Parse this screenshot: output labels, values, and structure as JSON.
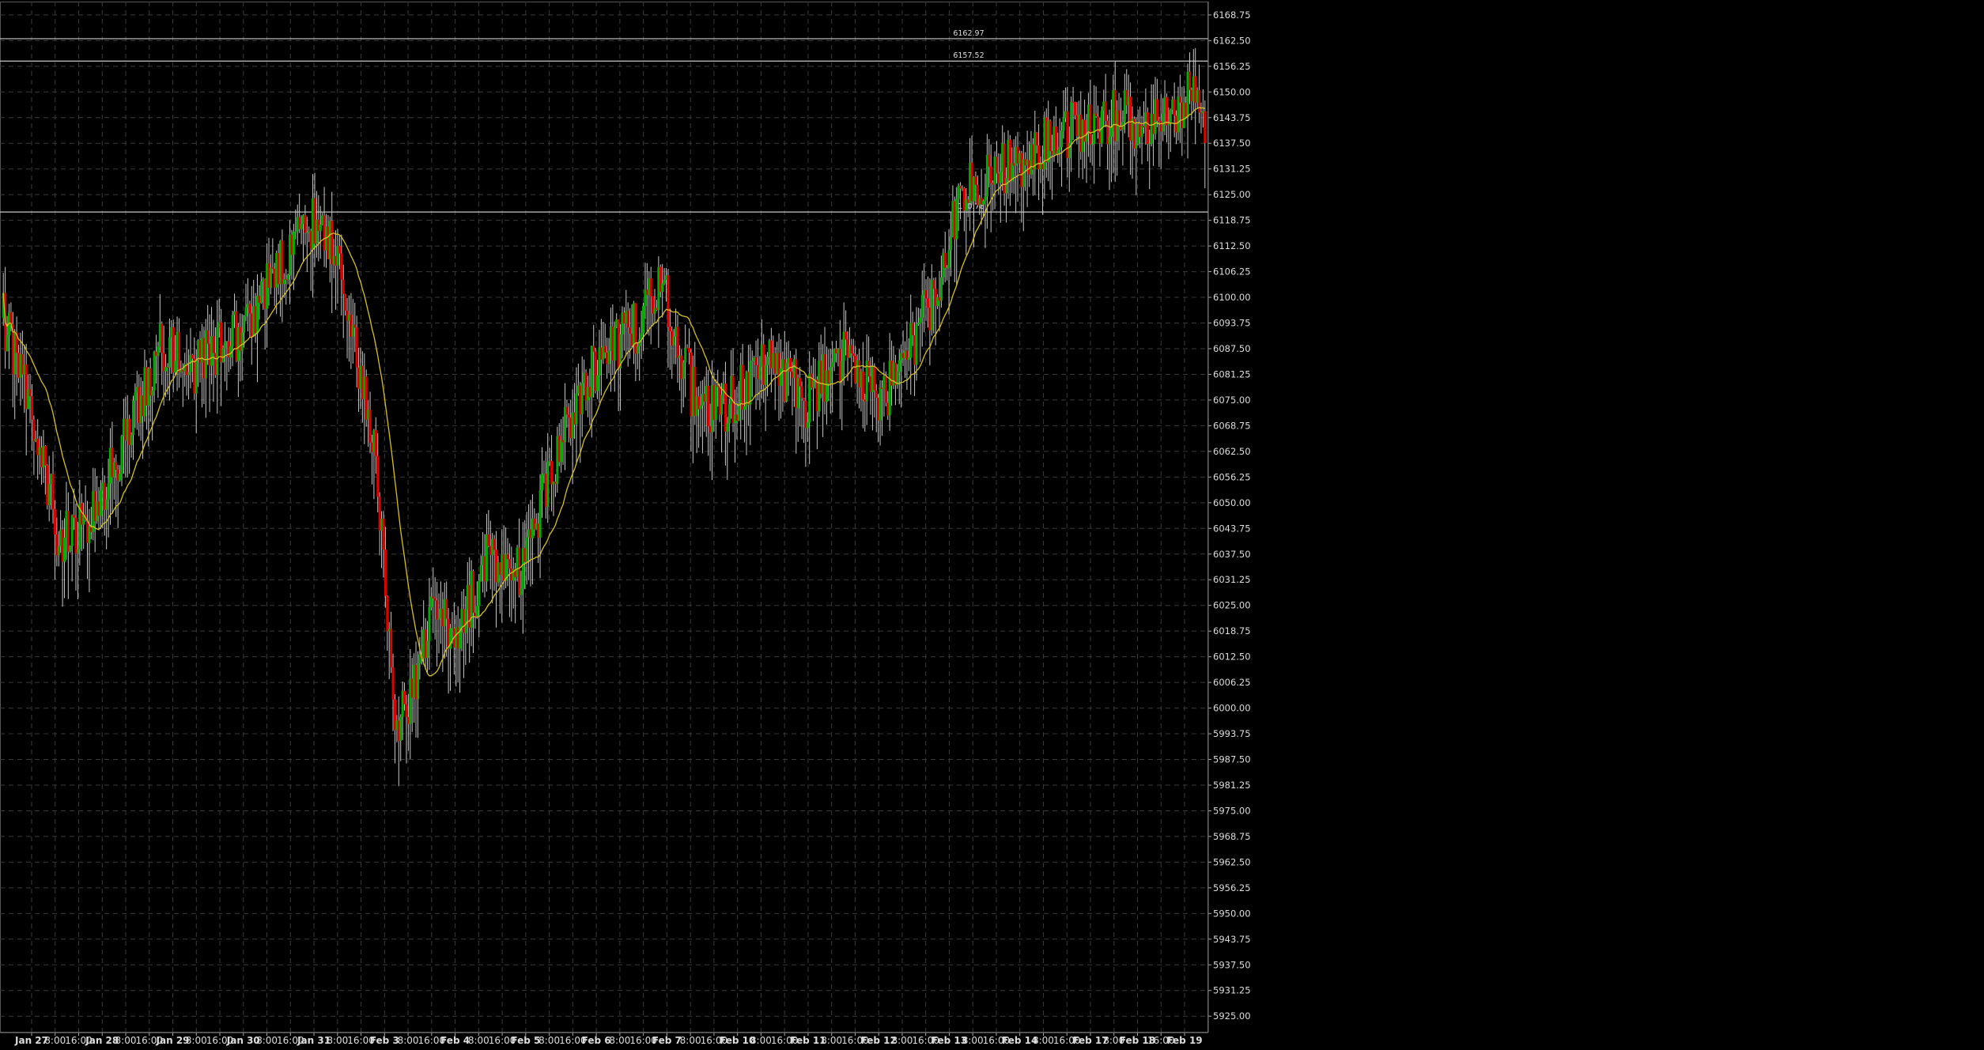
{
  "chart_data": {
    "type": "candlestick",
    "title": "",
    "ylim": [
      5921.0,
      6172.0
    ],
    "y_ticks": [
      6168.75,
      6162.5,
      6156.25,
      6150.0,
      6143.75,
      6137.5,
      6131.25,
      6125.0,
      6118.75,
      6112.5,
      6106.25,
      6100.0,
      6093.75,
      6087.5,
      6081.25,
      6075.0,
      6068.75,
      6062.5,
      6056.25,
      6050.0,
      6043.75,
      6037.5,
      6031.25,
      6025.0,
      6018.75,
      6012.5,
      6006.25,
      6000.0,
      5993.75,
      5987.5,
      5981.25,
      5975.0,
      5968.75,
      5962.5,
      5956.25,
      5950.0,
      5943.75,
      5937.5,
      5931.25,
      5925.0
    ],
    "y_tick_labels": [
      "6168.75",
      "6162.50",
      "6156.25",
      "6150.00",
      "6143.75",
      "6137.50",
      "6131.25",
      "6125.00",
      "6118.75",
      "6112.50",
      "6106.25",
      "6100.00",
      "6093.75",
      "6087.50",
      "6081.25",
      "6075.00",
      "6068.75",
      "6062.50",
      "6056.25",
      "6050.00",
      "6043.75",
      "6037.50",
      "6031.25",
      "6025.00",
      "6018.75",
      "6012.50",
      "6006.25",
      "6000.00",
      "5993.75",
      "5987.50",
      "5981.25",
      "5975.00",
      "5968.75",
      "5962.50",
      "5956.25",
      "5950.00",
      "5943.75",
      "5937.50",
      "5931.25",
      "5925.00"
    ],
    "x_ticks": [
      {
        "label": "Jan 27",
        "bold": true
      },
      {
        "label": "8:00",
        "bold": false
      },
      {
        "label": "16:00",
        "bold": false
      },
      {
        "label": "Jan 28",
        "bold": true
      },
      {
        "label": "8:00",
        "bold": false
      },
      {
        "label": "16:00",
        "bold": false
      },
      {
        "label": "Jan 29",
        "bold": true
      },
      {
        "label": "8:00",
        "bold": false
      },
      {
        "label": "16:00",
        "bold": false
      },
      {
        "label": "Jan 30",
        "bold": true
      },
      {
        "label": "8:00",
        "bold": false
      },
      {
        "label": "16:00",
        "bold": false
      },
      {
        "label": "Jan 31",
        "bold": true
      },
      {
        "label": "8:00",
        "bold": false
      },
      {
        "label": "16:00",
        "bold": false
      },
      {
        "label": "Feb 3",
        "bold": true
      },
      {
        "label": "8:00",
        "bold": false
      },
      {
        "label": "16:00",
        "bold": false
      },
      {
        "label": "Feb 4",
        "bold": true
      },
      {
        "label": "8:00",
        "bold": false
      },
      {
        "label": "16:00",
        "bold": false
      },
      {
        "label": "Feb 5",
        "bold": true
      },
      {
        "label": "8:00",
        "bold": false
      },
      {
        "label": "16:00",
        "bold": false
      },
      {
        "label": "Feb 6",
        "bold": true
      },
      {
        "label": "8:00",
        "bold": false
      },
      {
        "label": "16:00",
        "bold": false
      },
      {
        "label": "Feb 7",
        "bold": true
      },
      {
        "label": "8:00",
        "bold": false
      },
      {
        "label": "16:00",
        "bold": false
      },
      {
        "label": "Feb 10",
        "bold": true
      },
      {
        "label": "8:00",
        "bold": false
      },
      {
        "label": "16:00",
        "bold": false
      },
      {
        "label": "Feb 11",
        "bold": true
      },
      {
        "label": "8:00",
        "bold": false
      },
      {
        "label": "16:00",
        "bold": false
      },
      {
        "label": "Feb 12",
        "bold": true
      },
      {
        "label": "8:00",
        "bold": false
      },
      {
        "label": "16:00",
        "bold": false
      },
      {
        "label": "Feb 13",
        "bold": true
      },
      {
        "label": "8:00",
        "bold": false
      },
      {
        "label": "16:00",
        "bold": false
      },
      {
        "label": "Feb 14",
        "bold": true
      },
      {
        "label": "8:00",
        "bold": false
      },
      {
        "label": "16:00",
        "bold": false
      },
      {
        "label": "Feb 17",
        "bold": true
      },
      {
        "label": "8:00",
        "bold": false
      },
      {
        "label": "Feb 18",
        "bold": true
      },
      {
        "label": "16:00",
        "bold": false
      },
      {
        "label": "Feb 19",
        "bold": true
      }
    ],
    "levels": [
      {
        "value": 6162.97,
        "label": "6162.97"
      },
      {
        "value": 6157.52,
        "label": "6157.52"
      },
      {
        "value": 6120.78,
        "label": "6120.78"
      }
    ],
    "trend_anchors": [
      [
        0,
        6095
      ],
      [
        10,
        6080
      ],
      [
        30,
        6040
      ],
      [
        45,
        6046
      ],
      [
        60,
        6062
      ],
      [
        75,
        6080
      ],
      [
        85,
        6090
      ],
      [
        100,
        6083
      ],
      [
        120,
        6090
      ],
      [
        135,
        6099
      ],
      [
        140,
        6105
      ],
      [
        165,
        6120
      ],
      [
        180,
        6100
      ],
      [
        195,
        6060
      ],
      [
        205,
        5992
      ],
      [
        210,
        6000
      ],
      [
        225,
        6022
      ],
      [
        240,
        6020
      ],
      [
        252,
        6036
      ],
      [
        270,
        6033
      ],
      [
        290,
        6062
      ],
      [
        305,
        6081
      ],
      [
        330,
        6092
      ],
      [
        345,
        6103
      ],
      [
        360,
        6078
      ],
      [
        375,
        6072
      ],
      [
        390,
        6080
      ],
      [
        402,
        6084
      ],
      [
        420,
        6075
      ],
      [
        442,
        6087
      ],
      [
        460,
        6074
      ],
      [
        470,
        6083
      ],
      [
        487,
        6100
      ],
      [
        502,
        6125
      ],
      [
        530,
        6133
      ],
      [
        560,
        6141
      ],
      [
        585,
        6145
      ],
      [
        600,
        6140
      ],
      [
        612,
        6145
      ],
      [
        620,
        6150
      ],
      [
        629,
        6143
      ]
    ],
    "candles": {
      "count": 630,
      "seed": 20250127,
      "wick_max": 12
    },
    "colors": {
      "up": "#00b000",
      "down": "#e00000",
      "wick": "#c8c8c8",
      "ma": "#d8c020",
      "level": "#c8c8c8",
      "grid": "#3a3a3a",
      "axis_text": "#dcdcdc",
      "background": "#000000"
    },
    "grid": true,
    "legend": "none"
  }
}
